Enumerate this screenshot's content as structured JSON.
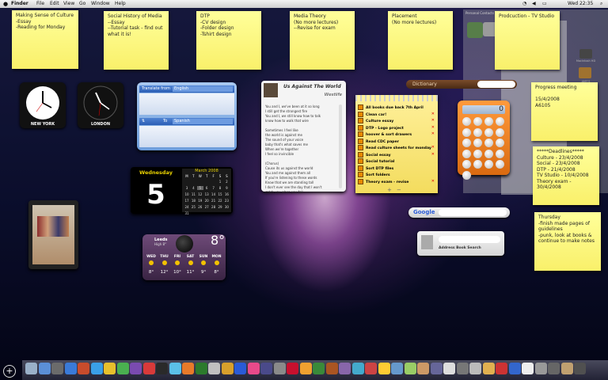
{
  "menubar": {
    "app": "Finder",
    "items": [
      "File",
      "Edit",
      "View",
      "Go",
      "Window",
      "Help"
    ],
    "clock": "Wed 22:35"
  },
  "stickies_top": [
    {
      "text": "Making Sense of Culture\n-Essay\n-Reading for Monday"
    },
    {
      "text": "Social History of Media\n--Essay\n--Tutorial task - find out\nwhat it is!"
    },
    {
      "text": "DTP\n-CV design\n-Folder design\n-Tshirt design"
    },
    {
      "text": "Media Theory\n(No more lectures)\n--Revise for exam"
    },
    {
      "text": "Placement\n(No more lectures)"
    },
    {
      "text": "Prodcuction - TV Studio"
    }
  ],
  "stickies_right": [
    {
      "text": "Progress meeting\n\n15/4/2008\nA6105"
    },
    {
      "text": "*****Deadlines*****\nCulture - 23/4/2008\nSocial - 23/4/2008\nDTP - 21/4/2008\nTV Studio - 10/4/2008\nTheory exam -\n30/4/2008"
    },
    {
      "text": "Thursday\n-finish made pages of\nguidelines\n-punk, look at books &\ncontinue to make notes"
    }
  ],
  "clocks": [
    {
      "city": "NEW YORK"
    },
    {
      "city": "LONDON"
    }
  ],
  "translate": {
    "from_label": "Translate from",
    "from_lang": "English",
    "to_label": "To",
    "to_lang": "Spanish"
  },
  "itunes": {
    "title": "Us Against The World",
    "artist": "Westlife",
    "lyrics": "You and I, we've been at it so long\nI still get the strongest fire\nYou and I, we still know how to talk\nknow how to walk that wire\n\nSometimes I feel like\nthe world is against me\nThe sound of your voice\nbaby that's what saves me\nWhen we're together\nI feel so invincible\n\n(Chorus)\nCause its us against the world\nYou and me against them all\nIf you're listening to these words\nKnow that we are standing tall\nI don't ever see the day that I won't\ncatch you when you fall"
  },
  "todo": {
    "items": [
      {
        "text": "All books due back 7th April",
        "crossed": false
      },
      {
        "text": "Clean car!",
        "crossed": true
      },
      {
        "text": "Culture essay",
        "crossed": true
      },
      {
        "text": "DTP - Logo project",
        "crossed": true
      },
      {
        "text": "hoover & sort drawers",
        "crossed": true
      },
      {
        "text": "Read CDC paper",
        "crossed": false
      },
      {
        "text": "Read culture sheets for monday",
        "crossed": true
      },
      {
        "text": "Social essay",
        "crossed": true
      },
      {
        "text": "Social tutorial",
        "crossed": false
      },
      {
        "text": "Sort DTP files",
        "crossed": false
      },
      {
        "text": "Sort folders",
        "crossed": false
      },
      {
        "text": "Theory exam - revise",
        "crossed": true
      }
    ],
    "plus": "+",
    "minus": "−"
  },
  "dictionary": {
    "label": "Dictionary"
  },
  "calculator": {
    "display": "0",
    "keys": [
      "mc",
      "m+",
      "m-",
      "mr",
      "C",
      "=",
      "/",
      "*",
      "7",
      "8",
      "9",
      "-",
      "4",
      "5",
      "6",
      "+",
      "1",
      "2",
      "3",
      "0",
      "."
    ]
  },
  "calendar": {
    "weekday": "Wednesday",
    "day": "5",
    "month": "March 2008",
    "headers": [
      "M",
      "T",
      "W",
      "T",
      "F",
      "S",
      "S"
    ],
    "days": [
      "",
      "",
      "",
      "",
      "",
      "1",
      "2",
      "3",
      "4",
      "5",
      "6",
      "7",
      "8",
      "9",
      "10",
      "11",
      "12",
      "13",
      "14",
      "15",
      "16",
      "17",
      "18",
      "19",
      "20",
      "21",
      "22",
      "23",
      "24",
      "25",
      "26",
      "27",
      "28",
      "29",
      "30",
      "31"
    ]
  },
  "weather": {
    "city": "Leeds",
    "sub": "High 8°",
    "temp": "8°",
    "days": [
      {
        "d": "WED",
        "t": "8°"
      },
      {
        "d": "THU",
        "t": "12°"
      },
      {
        "d": "FRI",
        "t": "10°"
      },
      {
        "d": "SAT",
        "t": "11°"
      },
      {
        "d": "SUN",
        "t": "9°"
      },
      {
        "d": "MON",
        "t": "8°"
      }
    ]
  },
  "google": {
    "label": "Google"
  },
  "addressbook": {
    "label": "Address Book Search"
  },
  "bgwindow": {
    "title": "Personal Contacts",
    "contact": "AMY'S",
    "disk": "Macintosh HD"
  },
  "dock": {
    "plus": "+"
  },
  "colors": {
    "sticky": "#ffff9a",
    "calc": "#e8821f",
    "todo": "#f3dc5e"
  }
}
